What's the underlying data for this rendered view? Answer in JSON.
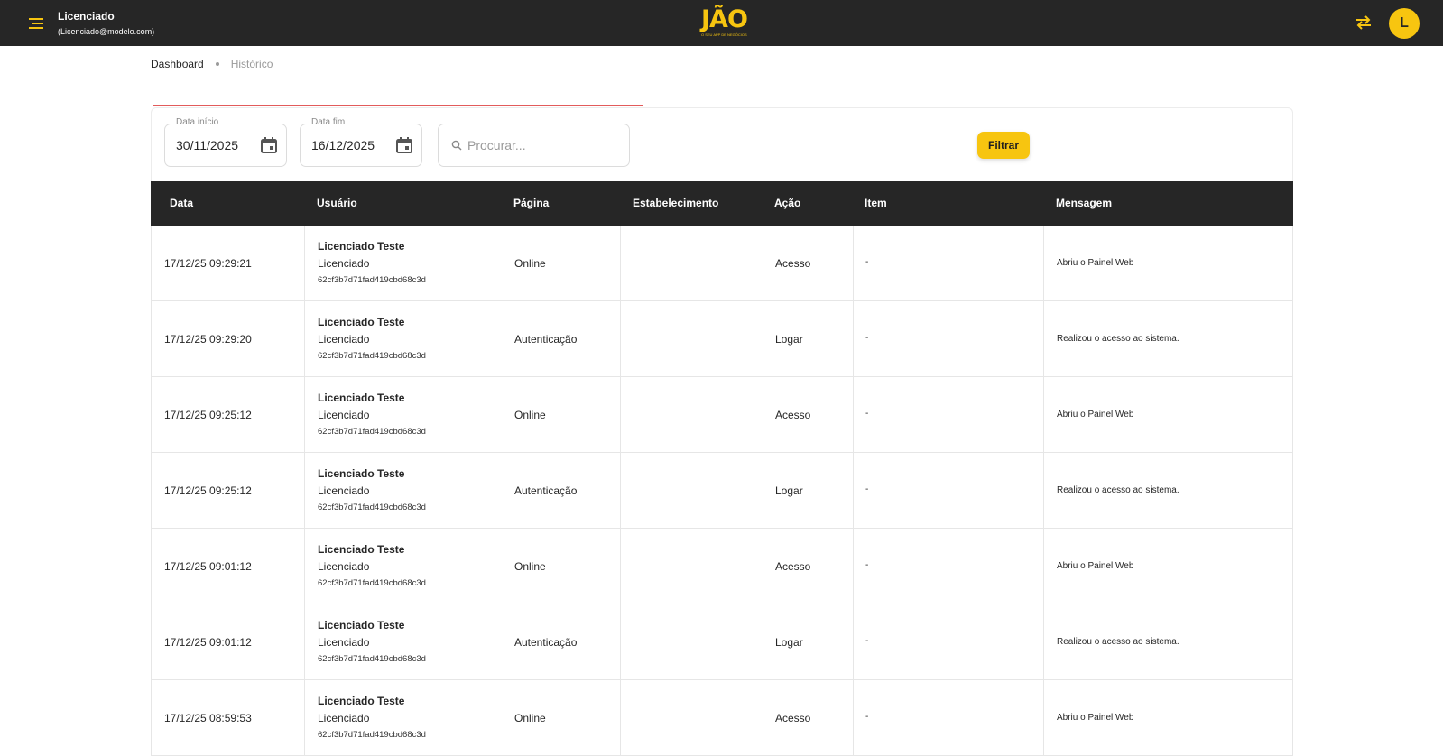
{
  "header": {
    "user_name": "Licenciado",
    "user_email": "(Licenciado@modelo.com)",
    "logo_text": "JÃO",
    "logo_tagline": "O SEU APP DE NEGÓCIOS",
    "avatar_letter": "L",
    "colors": {
      "bar": "#262626",
      "accent": "#f7c510"
    }
  },
  "breadcrumb": {
    "items": [
      "Dashboard",
      "Histórico"
    ]
  },
  "filters": {
    "date_start_label": "Data início",
    "date_start_value": "30/11/2025",
    "date_end_label": "Data fim",
    "date_end_value": "16/12/2025",
    "search_placeholder": "Procurar...",
    "filter_button": "Filtrar"
  },
  "table": {
    "columns": [
      "Data",
      "Usuário",
      "Página",
      "Estabelecimento",
      "Ação",
      "Item",
      "Mensagem"
    ],
    "rows": [
      {
        "date": "17/12/25 09:29:21",
        "user_name": "Licenciado Teste",
        "user_role": "Licenciado",
        "user_id": "62cf3b7d71fad419cbd68c3d",
        "page": "Online",
        "establishment": "",
        "action": "Acesso",
        "item": "-",
        "message": "Abriu o Painel Web"
      },
      {
        "date": "17/12/25 09:29:20",
        "user_name": "Licenciado Teste",
        "user_role": "Licenciado",
        "user_id": "62cf3b7d71fad419cbd68c3d",
        "page": "Autenticação",
        "establishment": "",
        "action": "Logar",
        "item": "-",
        "message": "Realizou o acesso ao sistema."
      },
      {
        "date": "17/12/25 09:25:12",
        "user_name": "Licenciado Teste",
        "user_role": "Licenciado",
        "user_id": "62cf3b7d71fad419cbd68c3d",
        "page": "Online",
        "establishment": "",
        "action": "Acesso",
        "item": "-",
        "message": "Abriu o Painel Web"
      },
      {
        "date": "17/12/25 09:25:12",
        "user_name": "Licenciado Teste",
        "user_role": "Licenciado",
        "user_id": "62cf3b7d71fad419cbd68c3d",
        "page": "Autenticação",
        "establishment": "",
        "action": "Logar",
        "item": "-",
        "message": "Realizou o acesso ao sistema."
      },
      {
        "date": "17/12/25 09:01:12",
        "user_name": "Licenciado Teste",
        "user_role": "Licenciado",
        "user_id": "62cf3b7d71fad419cbd68c3d",
        "page": "Online",
        "establishment": "",
        "action": "Acesso",
        "item": "-",
        "message": "Abriu o Painel Web"
      },
      {
        "date": "17/12/25 09:01:12",
        "user_name": "Licenciado Teste",
        "user_role": "Licenciado",
        "user_id": "62cf3b7d71fad419cbd68c3d",
        "page": "Autenticação",
        "establishment": "",
        "action": "Logar",
        "item": "-",
        "message": "Realizou o acesso ao sistema."
      },
      {
        "date": "17/12/25 08:59:53",
        "user_name": "Licenciado Teste",
        "user_role": "Licenciado",
        "user_id": "62cf3b7d71fad419cbd68c3d",
        "page": "Online",
        "establishment": "",
        "action": "Acesso",
        "item": "-",
        "message": "Abriu o Painel Web"
      }
    ]
  }
}
